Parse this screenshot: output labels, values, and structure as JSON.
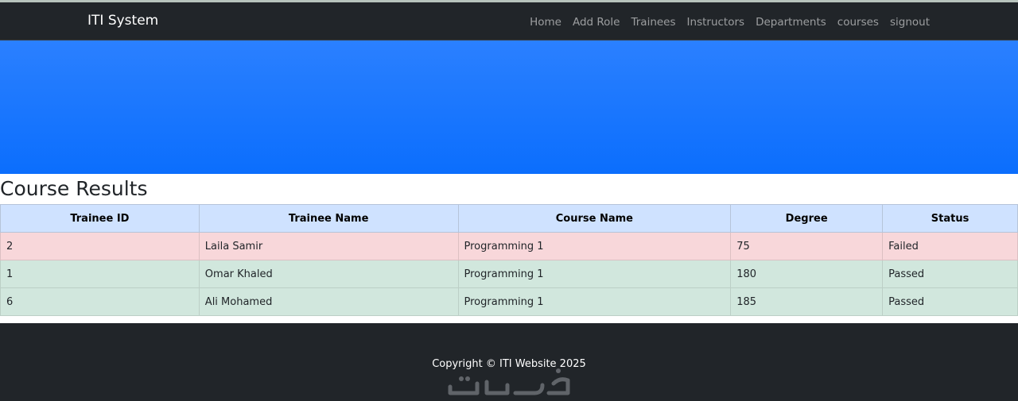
{
  "navbar": {
    "brand": "ITI System",
    "links": [
      "Home",
      "Add Role",
      "Trainees",
      "Instructors",
      "Departments",
      "courses",
      "signout"
    ]
  },
  "page": {
    "title": "Course Results"
  },
  "table": {
    "headers": [
      "Trainee ID",
      "Trainee Name",
      "Course Name",
      "Degree",
      "Status"
    ],
    "rows": [
      {
        "id": "2",
        "name": "Laila Samir",
        "course": "Programming 1",
        "degree": "75",
        "status": "Failed"
      },
      {
        "id": "1",
        "name": "Omar Khaled",
        "course": "Programming 1",
        "degree": "180",
        "status": "Passed"
      },
      {
        "id": "6",
        "name": "Ali Mohamed",
        "course": "Programming 1",
        "degree": "185",
        "status": "Passed"
      }
    ]
  },
  "footer": {
    "copyright": "Copyright © ITI Website 2025",
    "watermark": "خمسات"
  },
  "colors": {
    "navbar_bg": "#212529",
    "hero_blue": "#0d6efd",
    "header_row": "#cfe2ff",
    "failed_row": "#f8d7da",
    "passed_row": "#d1e7dd"
  }
}
